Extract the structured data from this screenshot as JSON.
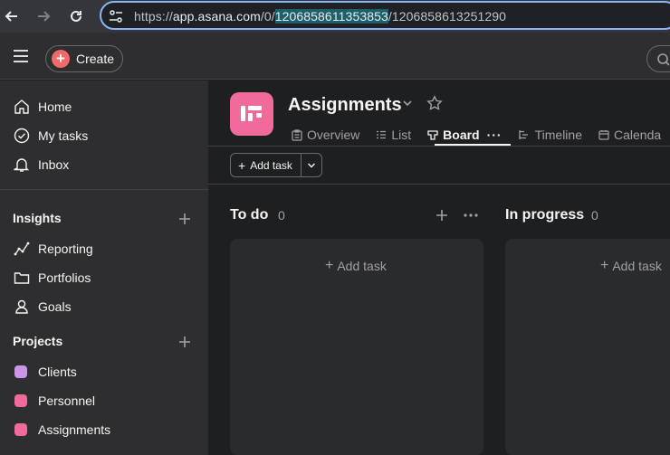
{
  "browser": {
    "url_prefix": "https://",
    "url_host": "app.asana.com",
    "url_path_1": "/0/",
    "url_highlight": "1206858611353853",
    "url_path_2": "/1206858613251290"
  },
  "topbar": {
    "create_label": "Create"
  },
  "sidebar": {
    "nav": [
      {
        "label": "Home",
        "icon": "home-icon"
      },
      {
        "label": "My tasks",
        "icon": "check-circle-icon"
      },
      {
        "label": "Inbox",
        "icon": "bell-icon"
      }
    ],
    "insights": {
      "title": "Insights",
      "items": [
        {
          "label": "Reporting",
          "icon": "reporting-icon"
        },
        {
          "label": "Portfolios",
          "icon": "folder-icon"
        },
        {
          "label": "Goals",
          "icon": "goals-icon"
        }
      ]
    },
    "projects": {
      "title": "Projects",
      "items": [
        {
          "label": "Clients",
          "color": "#cd95ea"
        },
        {
          "label": "Personnel",
          "color": "#f06a9b"
        },
        {
          "label": "Assignments",
          "color": "#f06a9b"
        }
      ]
    }
  },
  "project": {
    "title": "Assignments",
    "icon_color": "#f06a9b",
    "tabs": [
      {
        "label": "Overview",
        "icon": "overview-icon"
      },
      {
        "label": "List",
        "icon": "list-icon"
      },
      {
        "label": "Board",
        "icon": "board-icon",
        "active": true
      },
      {
        "label": "Timeline",
        "icon": "timeline-icon"
      },
      {
        "label": "Calenda",
        "icon": "calendar-icon"
      }
    ]
  },
  "toolbar": {
    "add_task_label": "Add task"
  },
  "columns": [
    {
      "title": "To do",
      "count": "0",
      "add_label": "Add task"
    },
    {
      "title": "In progress",
      "count": "0",
      "add_label": "Add task"
    }
  ]
}
